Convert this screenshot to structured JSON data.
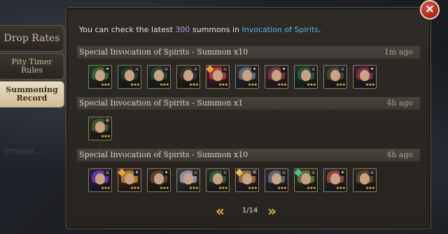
{
  "side_tabs": {
    "drop_rates": "Drop Rates",
    "pity_line1": "Pity Timer",
    "pity_line2": "Rules",
    "record_line1": "Summoning",
    "record_line2": "Record"
  },
  "background_text": "Present...",
  "info": {
    "prefix": "You can check the latest ",
    "count": "300",
    "middle": " summons in ",
    "link": "Invocation of Spirits",
    "suffix": "."
  },
  "records": [
    {
      "title": "Special Invocation of Spirits - Summon x10",
      "time": "1m ago",
      "heroes": [
        {
          "portrait": "hero-blond-warrior",
          "hood": "#3b6d3a",
          "bg": "#1f3a24",
          "elem": "none",
          "badge": "staff",
          "stars": "★★★"
        },
        {
          "portrait": "hero-orc-brute",
          "hood": "#2e3e33",
          "bg": "#1a2a23",
          "elem": "none",
          "badge": "sword",
          "stars": "★★★"
        },
        {
          "portrait": "hero-hooded-ranger",
          "hood": "#2f4a35",
          "bg": "#1c2f24",
          "elem": "none",
          "badge": "sword",
          "stars": "★★★"
        },
        {
          "portrait": "hero-hat-gunner",
          "hood": "#3a3a33",
          "bg": "#242620",
          "elem": "none",
          "badge": "sword",
          "stars": "★★★"
        },
        {
          "portrait": "hero-red-fiend",
          "hood": "#b83b3e",
          "bg": "#5a2030",
          "elem": "fire",
          "badge": "sword",
          "stars": "★★★"
        },
        {
          "portrait": "hero-grey-knight",
          "hood": "#6b7282",
          "bg": "#2b3140",
          "elem": "none",
          "badge": "staff",
          "stars": "★★★"
        },
        {
          "portrait": "hero-red-haired-rogue",
          "hood": "#7a3e35",
          "bg": "#3a2a3a",
          "elem": "none",
          "badge": "staff",
          "stars": "★★★"
        },
        {
          "portrait": "hero-green-hood",
          "hood": "#2f5a48",
          "bg": "#1b3a30",
          "elem": "none",
          "badge": "sword",
          "stars": "★★★"
        },
        {
          "portrait": "hero-dark-assassin",
          "hood": "#4a4a3a",
          "bg": "#2a2e26",
          "elem": "none",
          "badge": "sword",
          "stars": "★★★"
        },
        {
          "portrait": "hero-crimson-mage",
          "hood": "#8a2e3a",
          "bg": "#2a2638",
          "elem": "none",
          "badge": "staff",
          "stars": "★★★"
        }
      ]
    },
    {
      "title": "Special Invocation of Spirits - Summon x1",
      "time": "4h ago",
      "heroes": [
        {
          "portrait": "hero-hooded-scout",
          "hood": "#4d5a36",
          "bg": "#2a3322",
          "elem": "none",
          "badge": "shield",
          "stars": "★★★"
        }
      ]
    },
    {
      "title": "Special Invocation of Spirits - Summon x10",
      "time": "4h ago",
      "heroes": [
        {
          "portrait": "hero-violet-witch",
          "hood": "#6a3fa6",
          "bg": "#2b1f4a",
          "elem": "none",
          "badge": "sword",
          "stars": "★★★"
        },
        {
          "portrait": "hero-crowned-king",
          "hood": "#b88a2e",
          "bg": "#5a2a20",
          "elem": "fire",
          "badge": "staff",
          "stars": "★★★"
        },
        {
          "portrait": "hero-hooded-archer",
          "hood": "#5a4a36",
          "bg": "#2a2520",
          "elem": "none",
          "badge": "staff",
          "stars": "★★★"
        },
        {
          "portrait": "hero-winged-valkyrie",
          "hood": "#9aa0ae",
          "bg": "#3a3f4c",
          "elem": "none",
          "badge": "sword",
          "stars": "★★★"
        },
        {
          "portrait": "hero-goblin-raider",
          "hood": "#3e5e3a",
          "bg": "#20302a",
          "elem": "none",
          "badge": "sword",
          "stars": "★★★"
        },
        {
          "portrait": "hero-bearded-guardian",
          "hood": "#a8763a",
          "bg": "#2e2a40",
          "elem": "gold",
          "badge": "shield",
          "stars": "★★★"
        },
        {
          "portrait": "hero-steel-soldier",
          "hood": "#6a6e7a",
          "bg": "#2a2e3a",
          "elem": "none",
          "badge": "sword",
          "stars": "★★★"
        },
        {
          "portrait": "hero-forest-shaman",
          "hood": "#6a7a3a",
          "bg": "#2a3a26",
          "elem": "nature",
          "badge": "sword",
          "stars": "★★★"
        },
        {
          "portrait": "hero-redhead-duelist",
          "hood": "#a04a36",
          "bg": "#2e2a40",
          "elem": "none",
          "badge": "staff",
          "stars": "★★★"
        },
        {
          "portrait": "hero-cloaked-monk",
          "hood": "#5a4e3a",
          "bg": "#2e2a22",
          "elem": "none",
          "badge": "sword",
          "stars": "★★★"
        }
      ]
    }
  ],
  "pager": {
    "prev_icon": "double-chevron-left-icon",
    "prev": "«",
    "label": "1/14",
    "next": "»",
    "next_icon": "double-chevron-right-icon"
  },
  "close_label": "×"
}
